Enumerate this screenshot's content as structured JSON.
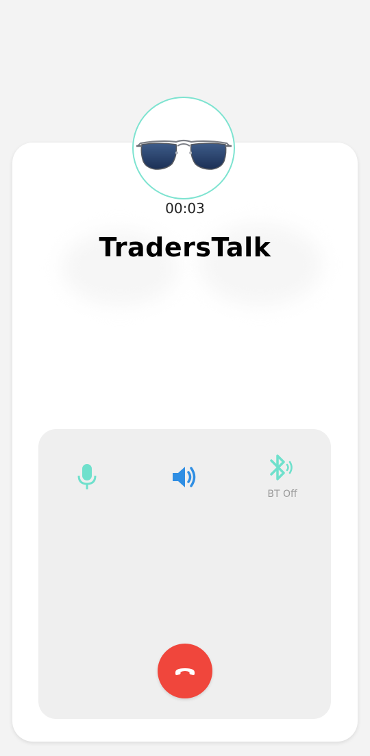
{
  "call": {
    "contact_name": "TradersTalk",
    "duration": "00:03",
    "avatar_image": "sunglasses"
  },
  "controls": {
    "mute_icon": "microphone-icon",
    "speaker_icon": "speaker-volume-icon",
    "bluetooth_icon": "bluetooth-audio-icon",
    "bluetooth_label": "BT Off",
    "end_call_icon": "phone-hangup-icon"
  },
  "colors": {
    "accent_teal": "#6fe0cc",
    "speaker_blue": "#2f8ee3",
    "hangup_red": "#f0463c",
    "card_bg": "#ffffff",
    "panel_bg": "#efefef",
    "page_bg": "#f3f3f3"
  }
}
